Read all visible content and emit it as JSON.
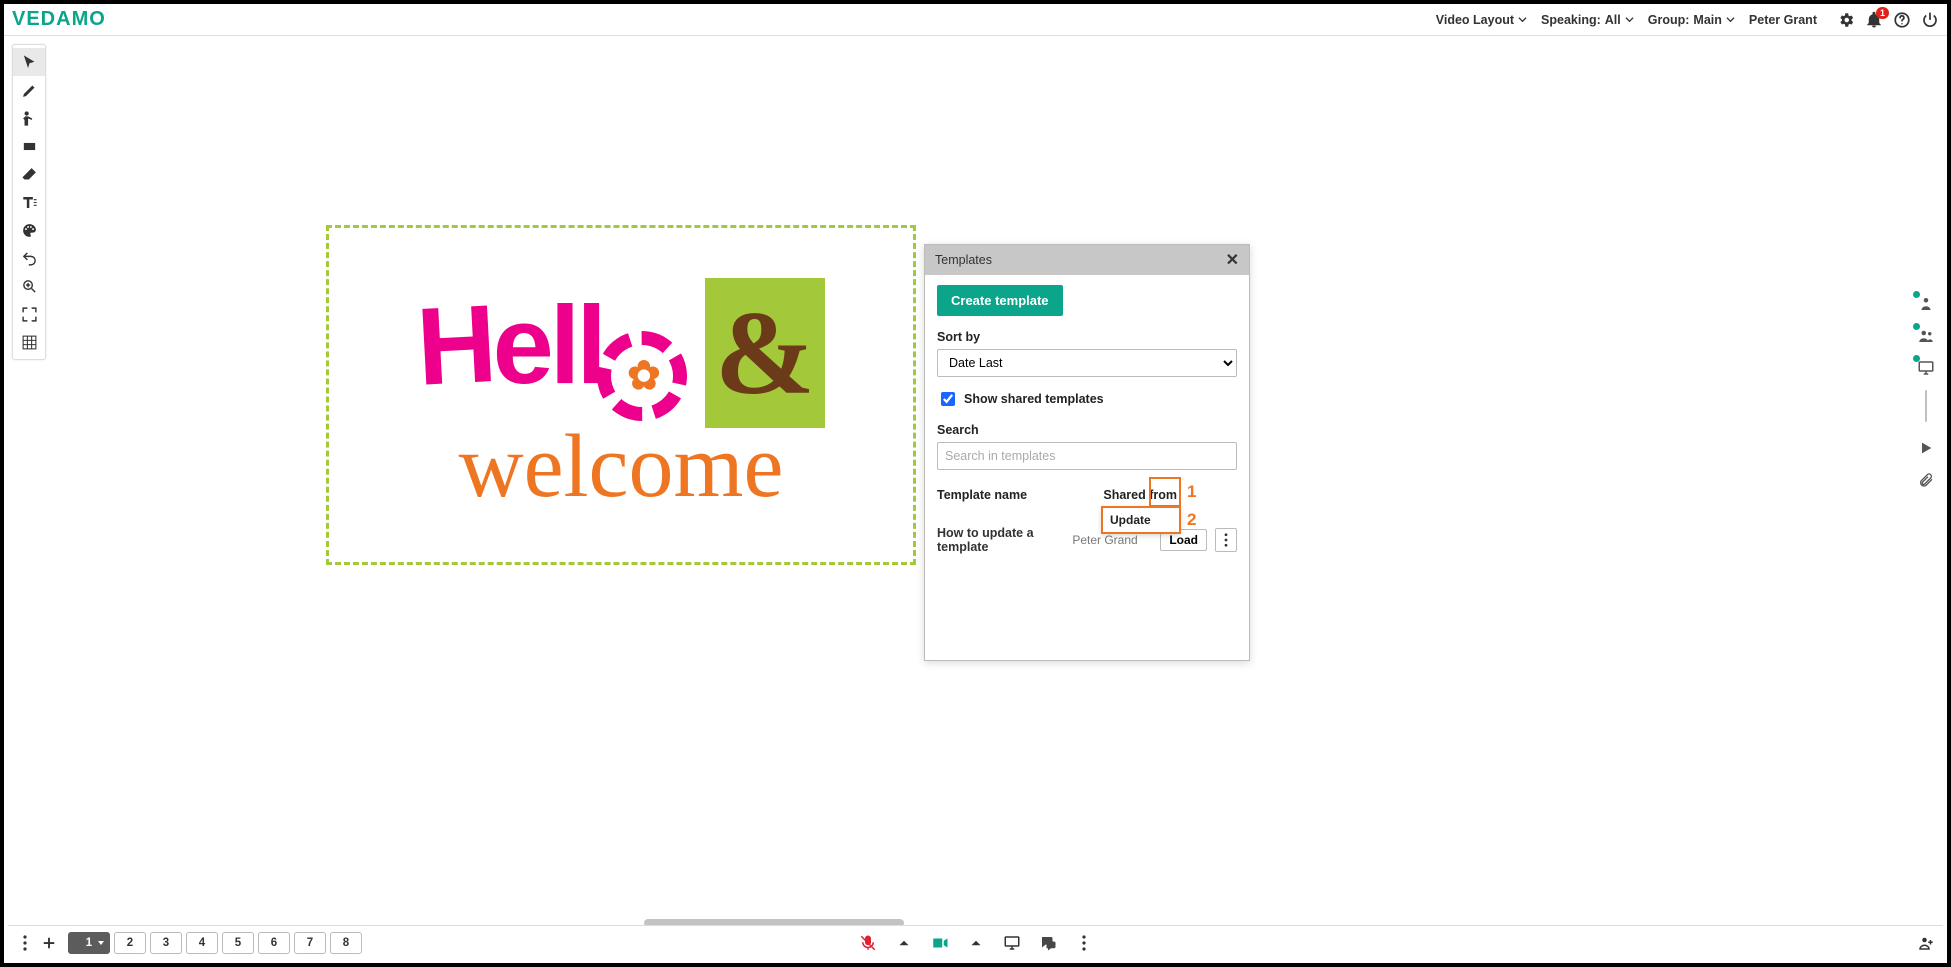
{
  "brand": "VEDAMO",
  "topbar": {
    "video_layout": "Video Layout",
    "speaking_label": "Speaking:",
    "speaking_value": "All",
    "group_label": "Group:",
    "group_value": "Main",
    "user_name": "Peter Grant",
    "notification_count": "1"
  },
  "canvas_art": {
    "hello": "Hello",
    "amp": "&",
    "welcome": "welcome"
  },
  "templates_panel": {
    "title": "Templates",
    "create_btn": "Create template",
    "sort_by_label": "Sort by",
    "sort_by_value": "Date Last",
    "show_shared_label": "Show shared templates",
    "show_shared_checked": true,
    "search_label": "Search",
    "search_placeholder": "Search in templates",
    "col_name": "Template name",
    "col_shared": "Shared from",
    "rows": [
      {
        "name": "How to update a template",
        "shared_from": "Peter Grand",
        "load_btn": "Load"
      }
    ],
    "update_menu_label": "Update"
  },
  "callouts": {
    "one": "1",
    "two": "2"
  },
  "pager": [
    "1",
    "2",
    "3",
    "4",
    "5",
    "6",
    "7",
    "8"
  ]
}
